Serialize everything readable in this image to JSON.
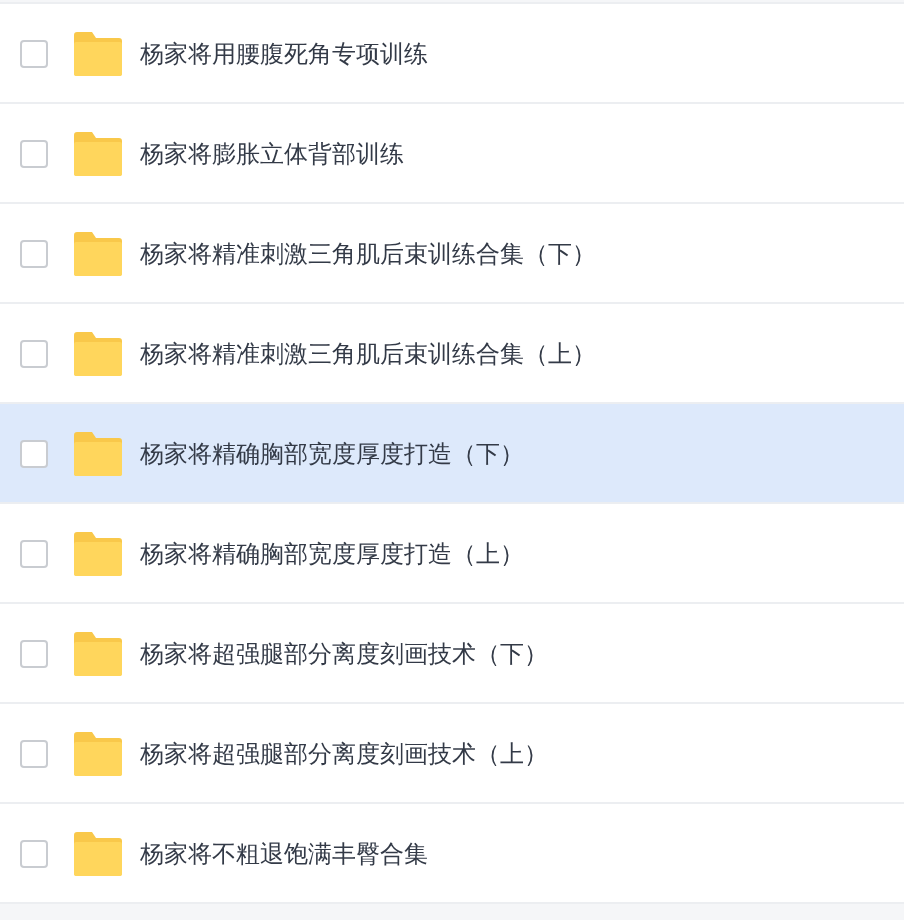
{
  "files": [
    {
      "name": "杨家将用腰腹死角专项训练",
      "checked": false,
      "highlighted": false
    },
    {
      "name": "杨家将膨胀立体背部训练",
      "checked": false,
      "highlighted": false
    },
    {
      "name": "杨家将精准刺激三角肌后束训练合集（下）",
      "checked": false,
      "highlighted": false
    },
    {
      "name": "杨家将精准刺激三角肌后束训练合集（上）",
      "checked": false,
      "highlighted": false
    },
    {
      "name": "杨家将精确胸部宽度厚度打造（下）",
      "checked": false,
      "highlighted": true
    },
    {
      "name": "杨家将精确胸部宽度厚度打造（上）",
      "checked": false,
      "highlighted": false
    },
    {
      "name": "杨家将超强腿部分离度刻画技术（下）",
      "checked": false,
      "highlighted": false
    },
    {
      "name": "杨家将超强腿部分离度刻画技术（上）",
      "checked": false,
      "highlighted": false
    },
    {
      "name": "杨家将不粗退饱满丰臀合集",
      "checked": false,
      "highlighted": false
    }
  ]
}
